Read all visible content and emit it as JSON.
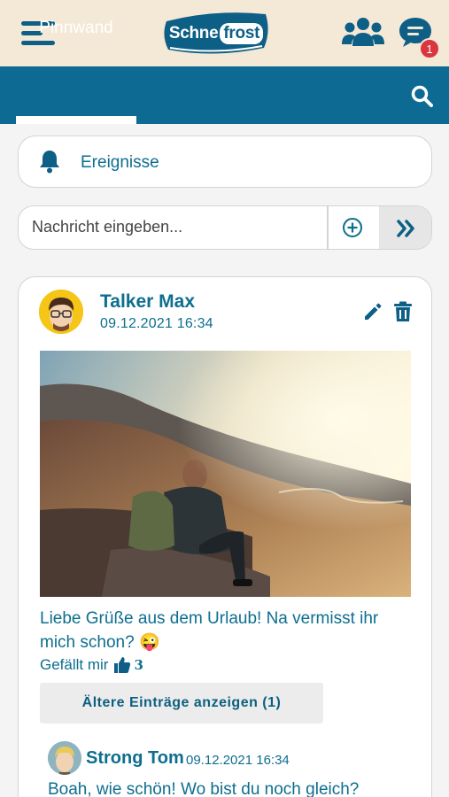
{
  "header": {
    "logo_part1": "Schne",
    "logo_part2": "frost",
    "chat_badge_count": "1",
    "brand_color": "#0d6a93"
  },
  "tabs": {
    "active_label": "Pinnwand"
  },
  "events": {
    "label": "Ereignisse"
  },
  "composer": {
    "placeholder": "Nachricht eingeben..."
  },
  "post": {
    "author": "Talker Max",
    "date": "09.12.2021 16:34",
    "text": "Liebe Grüße aus dem Urlaub! Na vermisst ihr mich schon? 😜",
    "likes_label": "Gefällt mir",
    "likes_count": "3",
    "older_entries_label": "Ältere Einträge anzeigen (1)"
  },
  "comment": {
    "author": "Strong Tom",
    "date": "09.12.2021 16:34",
    "text": "Boah, wie schön! Wo bist du noch gleich?"
  }
}
